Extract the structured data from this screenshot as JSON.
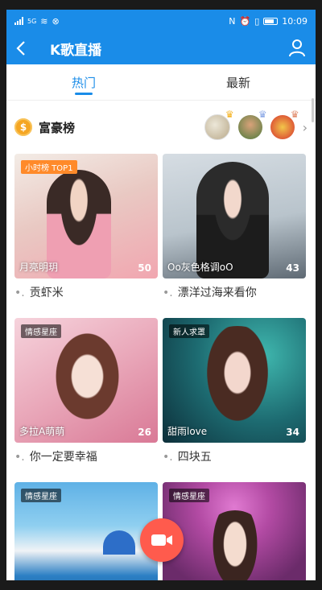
{
  "status": {
    "time": "10:09",
    "network": "5G"
  },
  "header": {
    "title": "K歌直播"
  },
  "tabs": [
    {
      "label": "热门"
    },
    {
      "label": "最新"
    }
  ],
  "rich_list": {
    "title": "富豪榜",
    "coin": "$"
  },
  "cards": [
    {
      "badge": "小时榜 TOP1",
      "nickname": "月亮明玥",
      "count": "50",
      "caption": "贡虾米"
    },
    {
      "badge": "",
      "nickname": "Oo灰色格调oO",
      "count": "43",
      "caption": "漂洋过海来看你"
    },
    {
      "badge": "情感星座",
      "nickname": "多拉A萌萌",
      "count": "26",
      "caption": "你一定要幸福"
    },
    {
      "badge": "新人求罩",
      "nickname": "甜雨love",
      "count": "34",
      "caption": "四块五"
    },
    {
      "badge": "情感星座",
      "nickname": "",
      "count": "",
      "caption": ""
    },
    {
      "badge": "情感星座",
      "nickname": "",
      "count": "",
      "caption": ""
    }
  ]
}
